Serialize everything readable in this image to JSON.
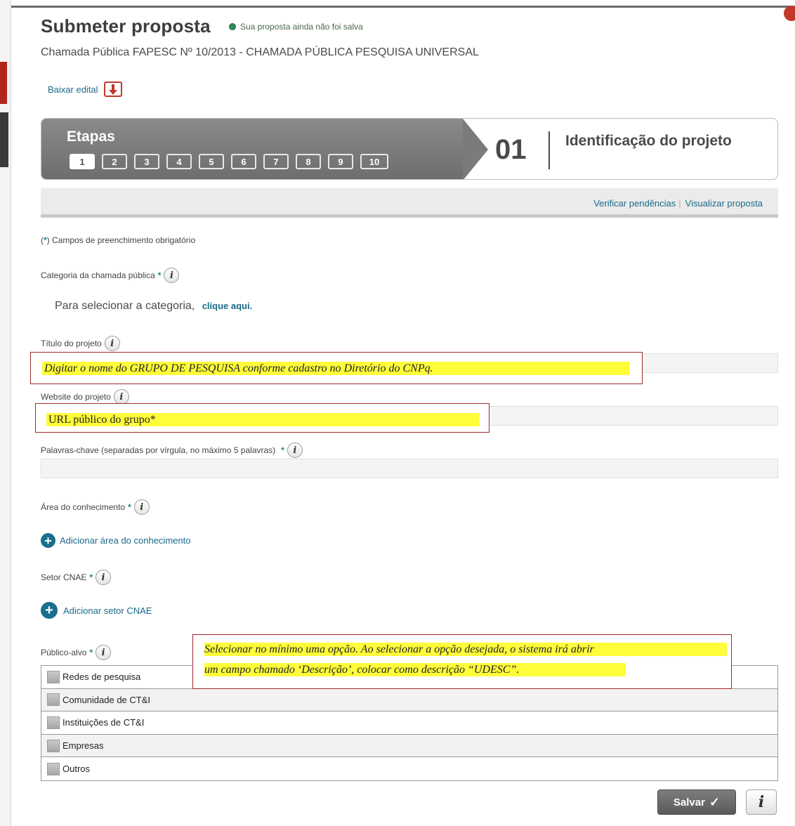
{
  "header": {
    "title": "Submeter proposta",
    "save_status": "Sua proposta ainda não foi salva",
    "subtitle": "Chamada Pública FAPESC Nº 10/2013 - CHAMADA PÚBLICA PESQUISA UNIVERSAL",
    "download_label": "Baixar edital"
  },
  "steps": {
    "label": "Etapas",
    "items": [
      "1",
      "2",
      "3",
      "4",
      "5",
      "6",
      "7",
      "8",
      "9",
      "10"
    ],
    "active": "1",
    "current_number": "01",
    "current_name": "Identificação do projeto"
  },
  "actions": {
    "check_pending": "Verificar pendências",
    "separator": "|",
    "view_proposal": "Visualizar proposta"
  },
  "form": {
    "required_open": "(",
    "required_star": "*",
    "required_note": ") Campos de preenchimento obrigatório",
    "category_label": "Categoria da chamada pública",
    "category_text": "Para selecionar a categoria,",
    "category_link": "clique aqui.",
    "title_label": "Título do projeto",
    "title_value": "",
    "website_label": "Website do projeto",
    "website_value": "",
    "keywords_label": "Palavras-chave (separadas por vírgula, no máximo 5 palavras)",
    "keywords_value": "",
    "area_label": "Área do conhecimento",
    "add_area": "Adicionar área do conhecimento",
    "cnae_label": "Setor CNAE",
    "add_cnae": "Adicionar setor CNAE",
    "audience_label": "Público-alvo",
    "star": "*",
    "audience_options": [
      "Redes de pesquisa",
      "Comunidade de CT&I",
      "Instituições de CT&I",
      "Empresas",
      "Outros"
    ]
  },
  "annotations": {
    "title_hint": "Digitar o nome do GRUPO DE PESQUISA  conforme cadastro no Diretório do CNPq.",
    "website_hint": "URL público do grupo*",
    "audience_hint_1": "Selecionar no mínimo uma opção. Ao selecionar a opção desejada, o sistema irá abrir",
    "audience_hint_2": "um campo chamado ‘Descrição’, colocar como descrição “UDESC”."
  },
  "buttons": {
    "save": "Salvar",
    "save_check": "✓",
    "info": "i"
  },
  "icons": {
    "info": "i",
    "plus": "+"
  },
  "colors": {
    "link": "#1a6a8a",
    "highlight": "#fffc3a",
    "annotation_border": "#a0282c",
    "status_dot": "#2e8b57"
  }
}
